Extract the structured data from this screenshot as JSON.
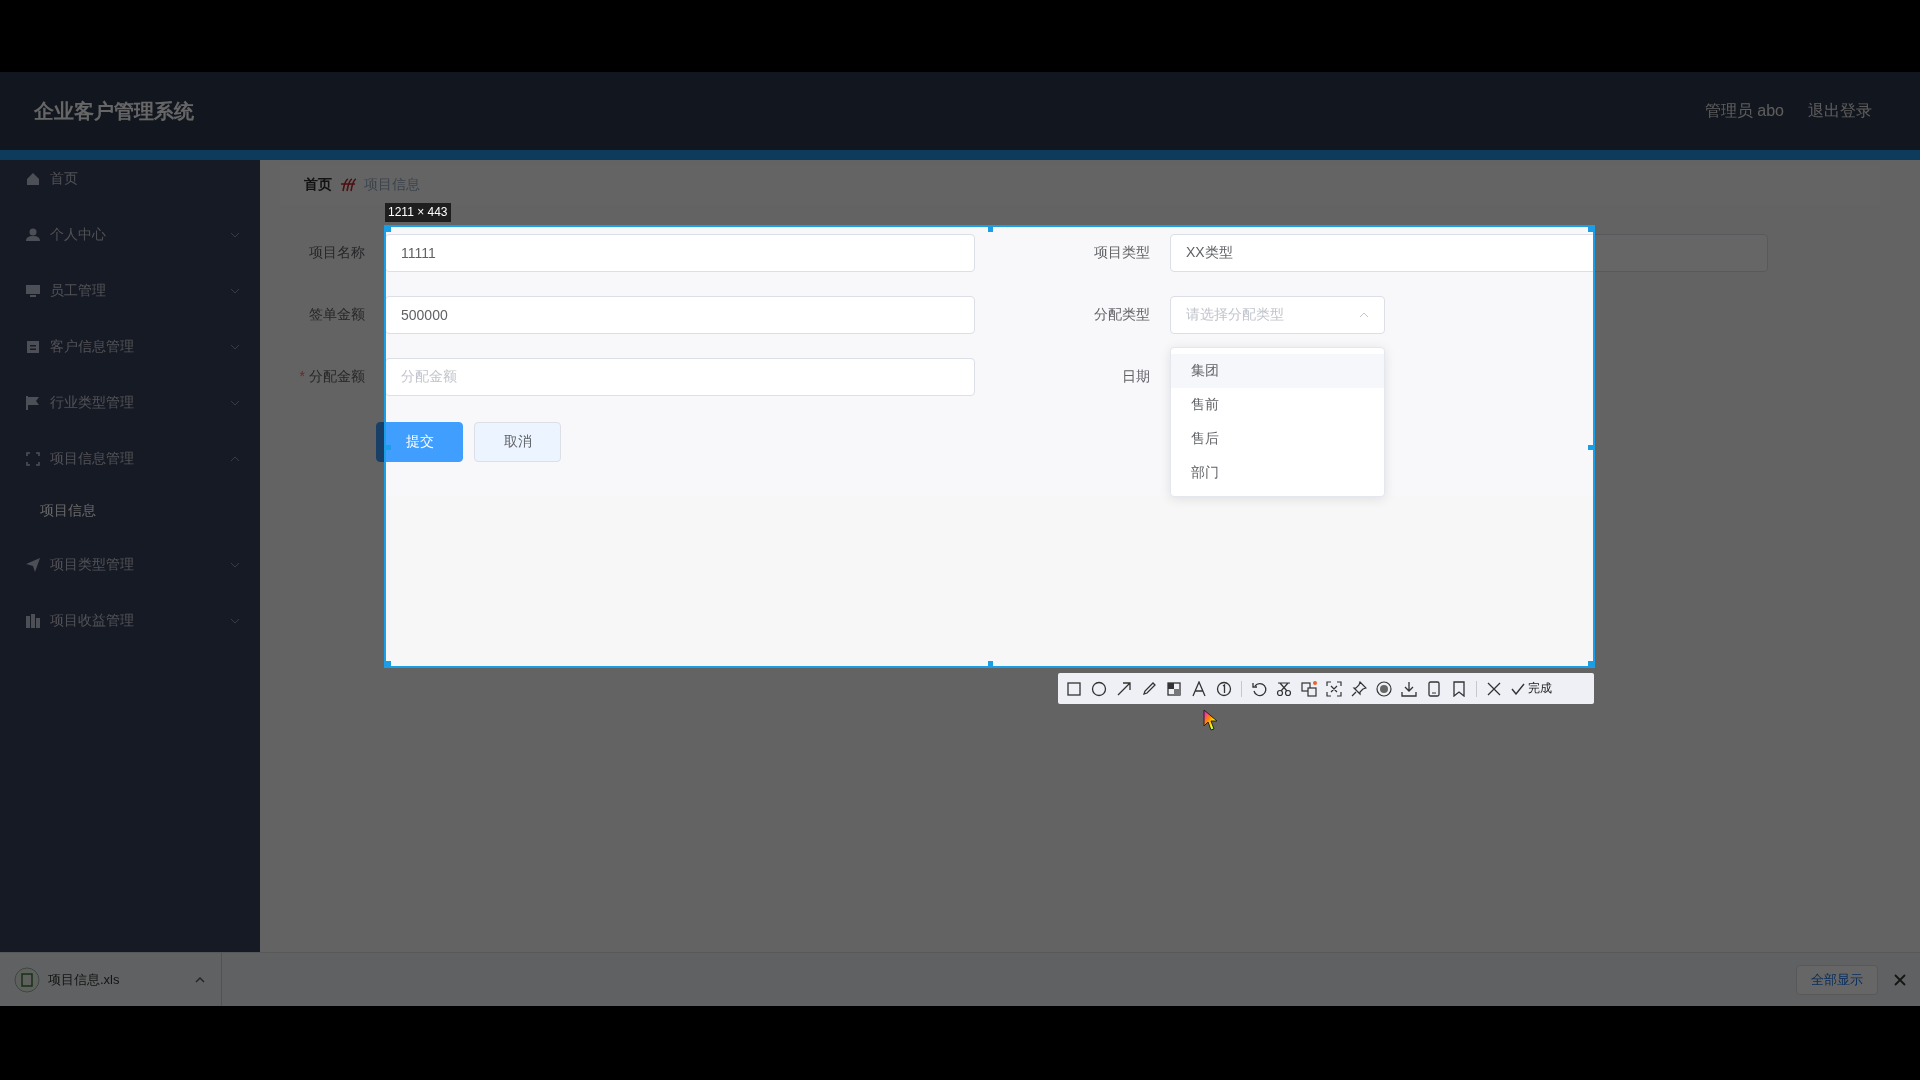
{
  "app": {
    "title": "企业客户管理系统",
    "user": "管理员 abo",
    "logout": "退出登录"
  },
  "sidebar": {
    "items": [
      {
        "label": "首页",
        "kind": "link"
      },
      {
        "label": "个人中心",
        "kind": "group",
        "expanded": false
      },
      {
        "label": "员工管理",
        "kind": "group",
        "expanded": false
      },
      {
        "label": "客户信息管理",
        "kind": "group",
        "expanded": false
      },
      {
        "label": "行业类型管理",
        "kind": "group",
        "expanded": false
      },
      {
        "label": "项目信息管理",
        "kind": "group",
        "expanded": true,
        "children": [
          {
            "label": "项目信息"
          }
        ]
      },
      {
        "label": "项目类型管理",
        "kind": "group",
        "expanded": false
      },
      {
        "label": "项目收益管理",
        "kind": "group",
        "expanded": false
      }
    ]
  },
  "breadcrumb": [
    "首页",
    "项目信息"
  ],
  "form": {
    "left_fields": [
      {
        "label": "项目名称",
        "value": "11111",
        "required": false
      },
      {
        "label": "签单金额",
        "value": "500000",
        "required": false
      },
      {
        "label": "分配金额",
        "placeholder": "分配金额",
        "required": true
      }
    ],
    "right_fields": [
      {
        "label": "项目类型",
        "kind": "input",
        "value": "XX类型"
      },
      {
        "label": "分配类型",
        "kind": "select",
        "placeholder": "请选择分配类型",
        "open": true
      },
      {
        "label": "日期",
        "kind": "date"
      }
    ],
    "dropdown": {
      "options": [
        {
          "label": "集团",
          "hovered": true
        },
        {
          "label": "售前",
          "hovered": false
        },
        {
          "label": "售后",
          "hovered": false
        },
        {
          "label": "部门",
          "hovered": false
        }
      ]
    },
    "required_mark": "*",
    "buttons": [
      {
        "label": "提交",
        "kind": "primary"
      },
      {
        "label": "取消",
        "kind": "default"
      }
    ]
  },
  "capture": {
    "size": "1211 × 443",
    "done": "完成"
  },
  "downloads": {
    "file": "项目信息.xls",
    "show_all": "全部显示"
  }
}
